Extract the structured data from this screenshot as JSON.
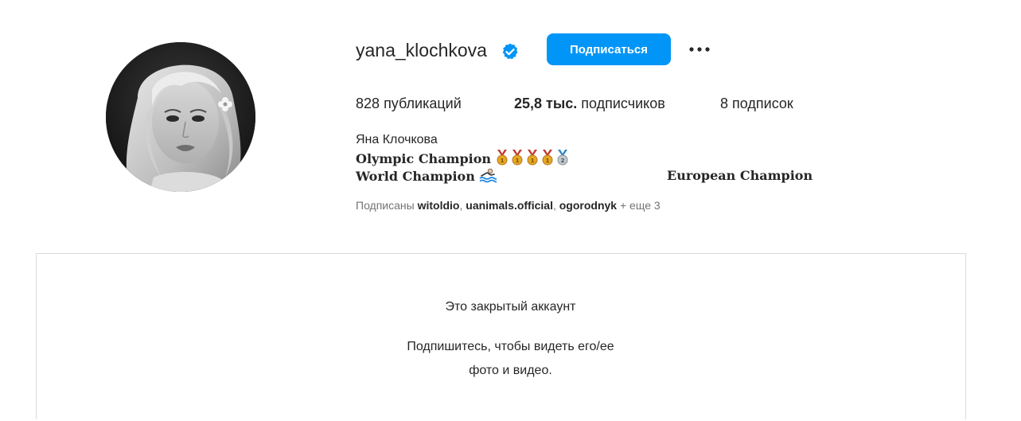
{
  "profile": {
    "username": "yana_klochkova",
    "follow_label": "Подписаться",
    "posts_count": "828",
    "posts_label": "публикаций",
    "followers_count": "25,8 тыс.",
    "followers_label": "подписчиков",
    "following_count": "8",
    "following_label": "подписок",
    "full_name": "Яна Клочкова",
    "bio_line1": "Olympic Champion",
    "bio_line2": "World Champion",
    "bio_line3": "European Champion"
  },
  "followed_by": {
    "prefix": "Подписаны",
    "accounts": [
      "witoldio",
      "uanimals.official",
      "ogorodnyk"
    ],
    "separator": ", ",
    "suffix": "+ еще 3"
  },
  "private_account": {
    "title": "Это закрытый аккаунт",
    "subtitle_line1": "Подпишитесь, чтобы видеть его/ее",
    "subtitle_line2": "фото и видео."
  },
  "icons": {
    "verified": "verified-badge-icon",
    "more": "more-options-icon",
    "medal_gold": "gold-medal-icon",
    "medal_silver": "silver-medal-icon",
    "swimmer": "swimmer-icon"
  },
  "colors": {
    "accent": "#0095f6",
    "text_primary": "#262626",
    "text_secondary": "#737373",
    "border": "#dbdbdb"
  }
}
